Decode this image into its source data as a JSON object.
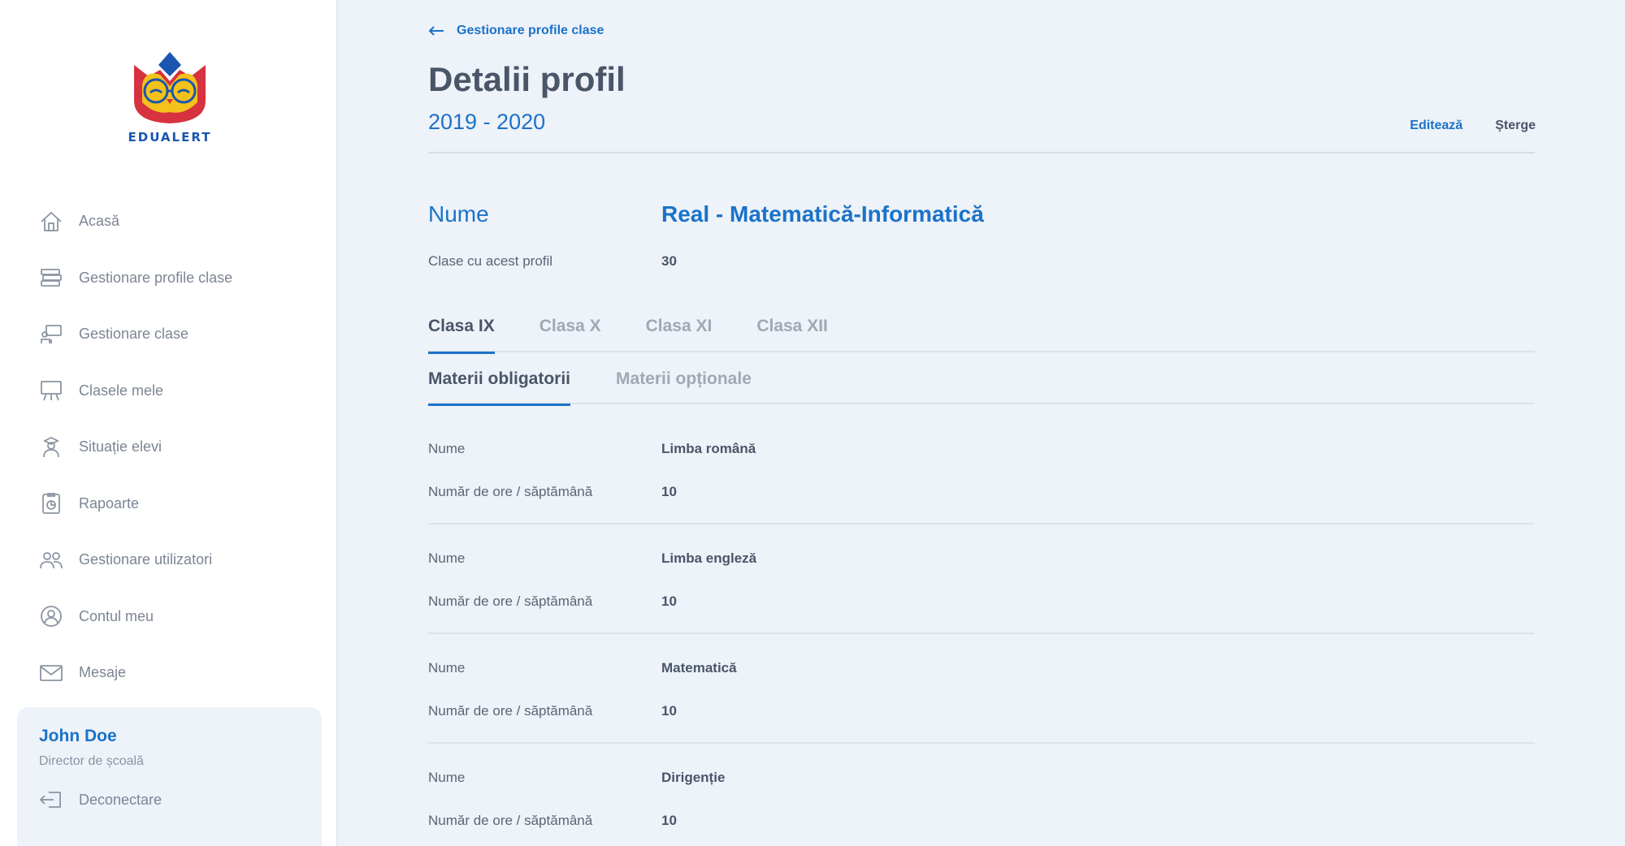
{
  "brand": {
    "name": "EDUALERT",
    "primary_color": "#1a73c9"
  },
  "sidebar": {
    "items": [
      {
        "label": "Acasă",
        "icon": "home-icon"
      },
      {
        "label": "Gestionare profile clase",
        "icon": "books-icon"
      },
      {
        "label": "Gestionare clase",
        "icon": "classroom-icon"
      },
      {
        "label": "Clasele mele",
        "icon": "board-icon"
      },
      {
        "label": "Situație elevi",
        "icon": "student-icon"
      },
      {
        "label": "Rapoarte",
        "icon": "report-icon"
      },
      {
        "label": "Gestionare utilizatori",
        "icon": "users-icon"
      },
      {
        "label": "Contul meu",
        "icon": "account-icon"
      },
      {
        "label": "Mesaje",
        "icon": "mail-icon"
      }
    ],
    "user": {
      "name": "John Doe",
      "role": "Director de școală",
      "logout_label": "Deconectare"
    }
  },
  "header": {
    "back_label": "Gestionare profile clase",
    "title": "Detalii profil",
    "year": "2019 - 2020",
    "edit_label": "Editează",
    "delete_label": "Șterge"
  },
  "profile": {
    "name_label": "Nume",
    "name_value": "Real - Matematică-Informatică",
    "classes_label": "Clase cu acest profil",
    "classes_value": "30"
  },
  "tabs": [
    "Clasa IX",
    "Clasa X",
    "Clasa XI",
    "Clasa XII"
  ],
  "active_tab": "Clasa IX",
  "subtabs": [
    "Materii obligatorii",
    "Materii opționale"
  ],
  "active_subtab": "Materii obligatorii",
  "subjects": [
    {
      "name_label": "Nume",
      "name": "Limba română",
      "hours_label": "Număr de ore / săptămână",
      "hours": "10"
    },
    {
      "name_label": "Nume",
      "name": "Limba engleză",
      "hours_label": "Număr de ore / săptămână",
      "hours": "10"
    },
    {
      "name_label": "Nume",
      "name": "Matematică",
      "hours_label": "Număr de ore / săptămână",
      "hours": "10"
    },
    {
      "name_label": "Nume",
      "name": "Dirigenție",
      "hours_label": "Număr de ore / săptămână",
      "hours": "10"
    }
  ]
}
